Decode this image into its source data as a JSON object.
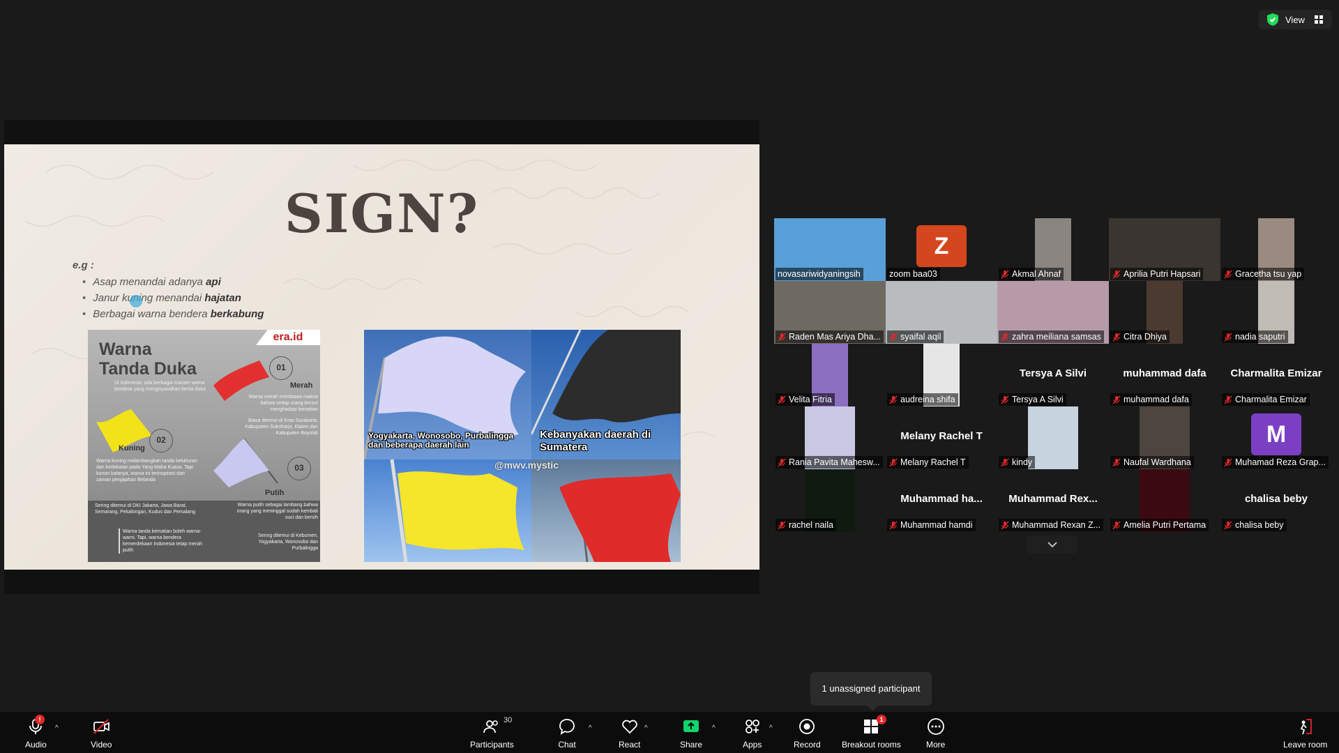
{
  "topbar": {
    "view_label": "View"
  },
  "slide": {
    "title": "SIGN?",
    "eg_label": "e.g :",
    "bullets": [
      {
        "text": "Asap menandai adanya ",
        "bold": "api"
      },
      {
        "text": "Janur kuning menandai ",
        "bold": "hajatan"
      },
      {
        "text": "Berbagai warna bendera ",
        "bold": "berkabung"
      }
    ],
    "infographic": {
      "title_line1": "Warna",
      "title_line2": "Tanda Duka",
      "logo": "era.id",
      "subtitle": "Di Indonesia, ada berbagai macam warna bendera yang mengisyaratkan berita duka",
      "flags": [
        {
          "num": "01",
          "label": "Merah",
          "color": "#e23030",
          "desc": "Warna merah membawa makna bahwa setiap orang berani menghadapi kematian",
          "region": "Biasa ditemui di Kota Surakarta, Kabupaten Sukoharjo, Klaten dan Kabupaten Boyolali"
        },
        {
          "num": "02",
          "label": "Kuning",
          "color": "#f2e21a",
          "desc": "Warna kuning melambangkan tanda keluhuran dan kedekatan pada Yang Maha Kuasa. Tapi konon katanya, warna ini terinspirasi dari zaman penjajahan Belanda",
          "region": "Sering ditemui di DKI Jakarta, Jawa Barat, Semarang, Pekalongan, Kudus dan Pemalang"
        },
        {
          "num": "03",
          "label": "Putih",
          "color": "#c9c8f0",
          "desc": "Warna putih sebagai lambang bahwa orang yang meninggal sudah kembali suci dan bersih",
          "region": "Sering ditemui di Kebumen, Yogyakarta, Wonosobo dan Purbalingga"
        }
      ],
      "footnote": "Warna tanda kematian boleh warna-warni. Tapi, warna bendera kemerdekaan Indonesia tetap merah putih"
    },
    "photos": {
      "caption_white": "Yogyakarta, Wonosobo, Purbalingga dan beberapa daerah lain",
      "caption_black": "Kebanyakan daerah di Sumatera",
      "watermark": "@mwv.mystic"
    }
  },
  "participants": [
    {
      "name": "novasariwidyaningsih",
      "type": "video",
      "bg": "#5aa0d8",
      "active": true,
      "muted": false
    },
    {
      "name": "zoom baa03",
      "type": "initial",
      "initial": "Z",
      "bg": "#d4471e",
      "muted": false
    },
    {
      "name": "Akmal Ahnaf",
      "type": "video",
      "bg": "#8a8580",
      "muted": true
    },
    {
      "name": "Aprilia Putri Hapsari",
      "type": "video",
      "bg": "#3a3530",
      "muted": true
    },
    {
      "name": "Gracetha tsu yap",
      "type": "video",
      "bg": "#9b8a80",
      "muted": true
    },
    {
      "name": "Raden Mas Ariya Dha...",
      "type": "video",
      "bg": "#6e6a62",
      "muted": true
    },
    {
      "name": "syaifal aqil",
      "type": "video",
      "bg": "#b9bcbf",
      "muted": true
    },
    {
      "name": "zahra meiliana samsas",
      "type": "video",
      "bg": "#b79aa8",
      "muted": true
    },
    {
      "name": "Citra Dhiya",
      "type": "video",
      "bg": "#4a3a30",
      "muted": true
    },
    {
      "name": "nadia saputri",
      "type": "video",
      "bg": "#c0bbb5",
      "muted": true
    },
    {
      "name": "Velita Fitria",
      "type": "video",
      "bg": "#8d6fc2",
      "muted": true
    },
    {
      "name": "audreina shifa",
      "type": "video",
      "bg": "#e6e6e6",
      "muted": true
    },
    {
      "name": "Tersya A Silvi",
      "type": "name",
      "muted": true
    },
    {
      "name": "muhammad dafa",
      "type": "name",
      "muted": true
    },
    {
      "name": "Charmalita Emizar",
      "type": "name",
      "muted": true
    },
    {
      "name": "Rania Pavita Mahesw...",
      "type": "video",
      "bg": "#c8c8e2",
      "muted": true
    },
    {
      "name": "Melany Rachel T",
      "type": "name",
      "muted": true
    },
    {
      "name": "kindy",
      "type": "video",
      "bg": "#c7d3df",
      "muted": true
    },
    {
      "name": "Naufal Wardhana",
      "type": "video",
      "bg": "#4c4540",
      "muted": true
    },
    {
      "name": "Muhamad Reza Grap...",
      "type": "initial",
      "initial": "M",
      "bg": "#7b3fc4",
      "muted": true
    },
    {
      "name": "rachel naila",
      "type": "video",
      "bg": "#0f1a10",
      "muted": true
    },
    {
      "name": "Muhammad hamdi",
      "type": "name",
      "big": "Muhammad  ha...",
      "muted": true
    },
    {
      "name": "Muhammad Rexan Z...",
      "type": "name",
      "big": "Muhammad  Rex...",
      "muted": true
    },
    {
      "name": "Amelia Putri Pertama",
      "type": "video",
      "bg": "#3a0a10",
      "muted": true
    },
    {
      "name": "chalisa beby",
      "type": "name",
      "muted": true
    }
  ],
  "tooltip": "1 unassigned participant",
  "toolbar": {
    "audio": "Audio",
    "video": "Video",
    "participants": "Participants",
    "participants_count": "30",
    "chat": "Chat",
    "react": "React",
    "share": "Share",
    "apps": "Apps",
    "record": "Record",
    "breakout": "Breakout rooms",
    "breakout_badge": "1",
    "more": "More",
    "leave": "Leave room",
    "audio_badge": "!"
  },
  "colors": {
    "accent_green": "#23d959",
    "share_green": "#0fd46c",
    "badge_red": "#e02828"
  }
}
